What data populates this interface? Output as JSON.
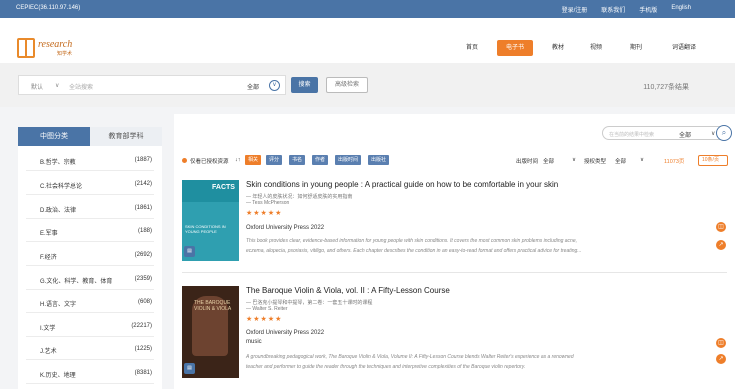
{
  "topbar": {
    "ip": "CEPIEC(36.110.97.146)",
    "links": [
      "登录/注册",
      "联系我们",
      "手机版",
      "English"
    ]
  },
  "logo": {
    "text": "research",
    "sub": "知学术"
  },
  "nav": [
    "首页",
    "电子书",
    "教材",
    "视频",
    "期刊",
    "词语翻译"
  ],
  "search": {
    "scope": "默认",
    "scope_caret": "∨",
    "placeholder": "全站搜索",
    "field": "全部",
    "field_caret": "∨",
    "button": "搜索",
    "advanced": "高级检索",
    "total": "110,727条结果"
  },
  "sidebar": {
    "tab_active": "中图分类",
    "tab_other": "教育部学科",
    "categories": [
      {
        "name": "B.哲学、宗教",
        "count": "(1887)"
      },
      {
        "name": "C.社会科学总论",
        "count": "(2142)"
      },
      {
        "name": "D.政治、法律",
        "count": "(1861)"
      },
      {
        "name": "E.军事",
        "count": "(188)"
      },
      {
        "name": "F.经济",
        "count": "(2692)"
      },
      {
        "name": "G.文化、科学、教育、体育",
        "count": "(2359)"
      },
      {
        "name": "H.语言、文字",
        "count": "(608)"
      },
      {
        "name": "I.文学",
        "count": "(22217)"
      },
      {
        "name": "J.艺术",
        "count": "(1225)"
      },
      {
        "name": "K.历史、地理",
        "count": "(8381)"
      }
    ]
  },
  "filterbar": {
    "search_placeholder": "在当前的结果中检索",
    "search_scope": "全部",
    "only_label": "仅看已授权资源",
    "sort_icon": "↓↑",
    "chips": [
      "相关",
      "评分",
      "书名",
      "作者",
      "出版时间",
      "出版社"
    ],
    "pub_time_label": "出版时间",
    "pub_time_value": "全部",
    "auth_label": "授权类型",
    "auth_value": "全部",
    "pages": "11073页",
    "per_page": "10条/页"
  },
  "results": [
    {
      "title": "Skin conditions in young people : A practical guide on how to be comfortable in your skin",
      "subtitle": "— 年轻人的皮肤状况：如何舒适皮肤的实用指南",
      "author": "— Tess McPherson",
      "stars": "★★★★★",
      "publisher": "Oxford University Press 2022",
      "extra": "",
      "desc1": "This book provides clear, evidence-based information for young people with skin conditions. It covers the most common skin problems including acne,",
      "desc2": "eczema, alopecia, psoriasis, vitiligo, and others. Each chapter describes the condition in an easy-to-read format and offers practical advice for treating...",
      "cover_label": "SKIN CONDITIONS IN YOUNG PEOPLE",
      "cover_series": "FACTS",
      "cover_color": "#2f9fb0"
    },
    {
      "title": "The Baroque Violin & Viola, vol. II : A Fifty-Lesson Course",
      "subtitle": "— 巴洛克小提琴和中提琴，第二卷：一套五十课时的课程",
      "author": "— Walter S. Reiter",
      "stars": "★★★★★",
      "publisher": "Oxford University Press 2022",
      "extra": "music",
      "desc1": "A groundbreaking pedagogical work, The Baroque Violin & Viola, Volume II: A Fifty-Lesson Course blends Walter Reiter's experience as a renowned",
      "desc2": "teacher and performer to guide the reader through the techniques and interpretive complexities of the Baroque violin repertory.",
      "cover_label": "THE BAROQUE VIOLIN & VIOLA",
      "cover_series": "",
      "cover_color": "#3b2418"
    }
  ],
  "colors": {
    "brand": "#4a74a6",
    "accent": "#ee7e2a"
  }
}
